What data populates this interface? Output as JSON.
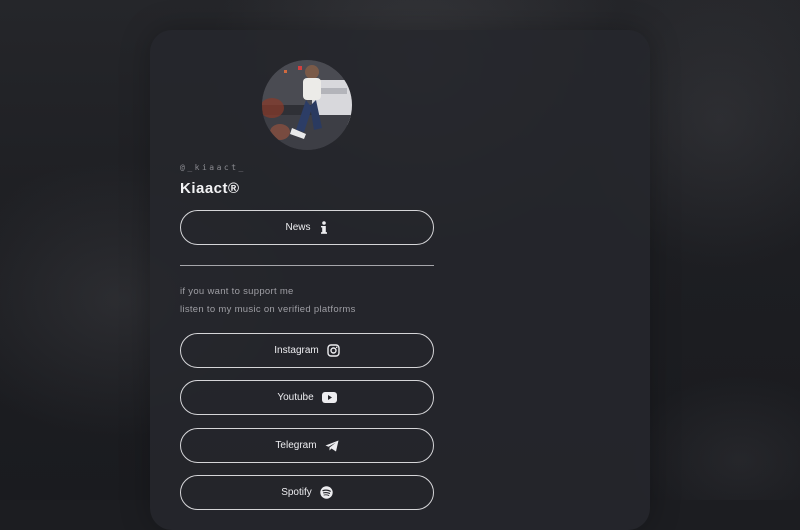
{
  "profile": {
    "handle": "@_kiaact_",
    "name": "Kiaact®"
  },
  "buttons": {
    "news": {
      "label": "News",
      "icon": "info-icon"
    },
    "instagram": {
      "label": "Instagram",
      "icon": "instagram-icon"
    },
    "youtube": {
      "label": "Youtube",
      "icon": "youtube-icon"
    },
    "telegram": {
      "label": "Telegram",
      "icon": "telegram-icon"
    },
    "spotify": {
      "label": "Spotify",
      "icon": "spotify-icon"
    }
  },
  "support_text": {
    "line1": "if you want to support me",
    "line2": "listen to my music on verified platforms"
  },
  "colors": {
    "background": "#1c1d21",
    "card": "#26272c",
    "text": "#ededf0",
    "muted": "#9e9ea4",
    "border": "#d5d5d8"
  }
}
